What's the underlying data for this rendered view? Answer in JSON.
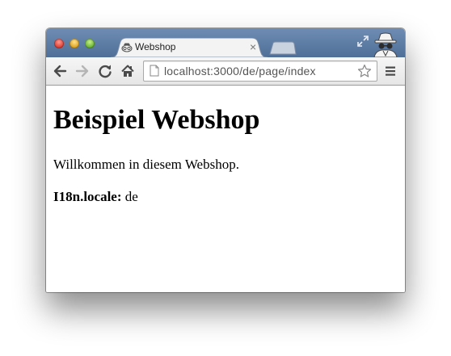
{
  "tab": {
    "title": "Webshop",
    "close": "×"
  },
  "address_bar": {
    "url": "localhost:3000/de/page/index"
  },
  "page": {
    "heading": "Beispiel Webshop",
    "welcome": "Willkommen in diesem Webshop.",
    "locale_label": "I18n.locale:",
    "locale_value": "de"
  },
  "icons": {
    "back": "back-arrow-icon",
    "forward": "forward-arrow-icon",
    "reload": "reload-icon",
    "home": "home-icon",
    "page": "page-icon",
    "bookmark": "star-icon",
    "menu": "menu-icon",
    "incognito": "incognito-icon",
    "fullscreen": "fullscreen-icon"
  },
  "colors": {
    "titlebar": "#5a7aa3",
    "toolbar": "#ececec",
    "close_red": "#e0443a",
    "minimize_yellow": "#e0a92a",
    "zoom_green": "#6fb83a"
  }
}
